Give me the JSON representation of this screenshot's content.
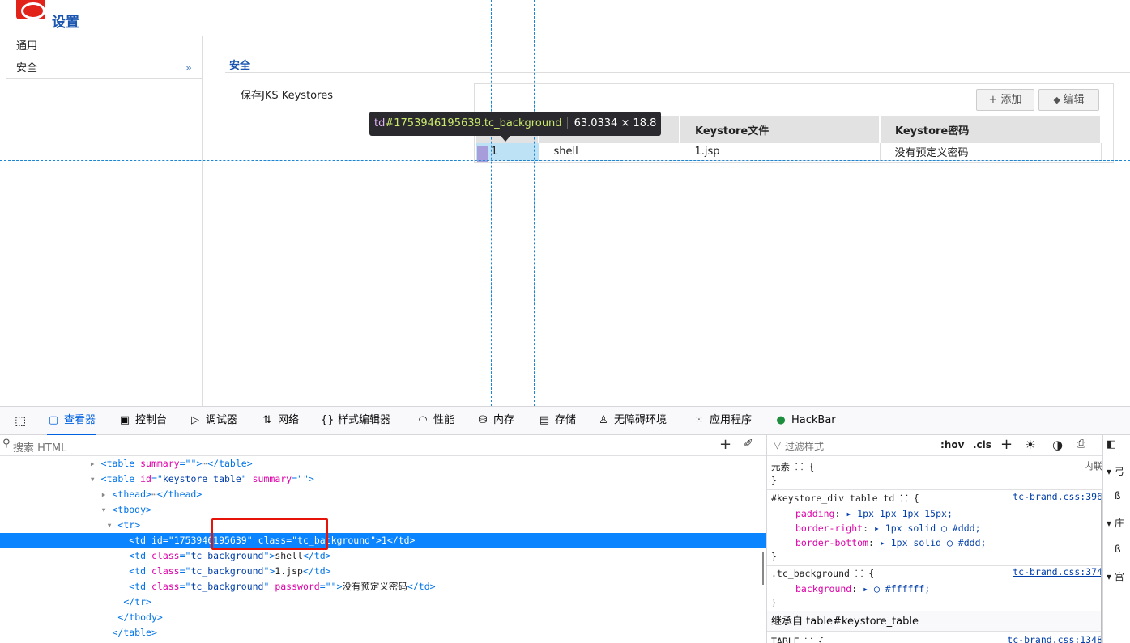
{
  "page": {
    "title": "设置"
  },
  "sidebar": {
    "items": [
      {
        "label": "通用"
      },
      {
        "label": "安全"
      }
    ],
    "chevron": "»"
  },
  "section": {
    "title": "安全",
    "keystore_label": "保存JKS Keystores"
  },
  "buttons": {
    "add": "添加",
    "edit": "编辑"
  },
  "keystore_table": {
    "headers": [
      "",
      "",
      "Keystore文件",
      "Keystore密码"
    ],
    "rows": [
      [
        "1",
        "shell",
        "1.jsp",
        "没有预定义密码"
      ]
    ]
  },
  "tooltip": {
    "tag": "td",
    "id": "#1753946195639",
    "cls": ".tc_background",
    "dims": "63.0334 × 18.8"
  },
  "devtools": {
    "tabs": [
      "查看器",
      "控制台",
      "调试器",
      "网络",
      "样式编辑器",
      "性能",
      "内存",
      "存储",
      "无障碍环境",
      "应用程序",
      "HackBar"
    ],
    "search_placeholder": "搜索 HTML",
    "filter_placeholder": "过滤样式",
    "hov": ":hov",
    "cls": ".cls",
    "markup": [
      {
        "indent": 14,
        "tw": "▸",
        "parts": [
          [
            "tg",
            "<table "
          ],
          [
            "an",
            "summary"
          ],
          [
            "tg",
            "=\""
          ],
          [
            "av",
            ""
          ],
          [
            "tg",
            "\">"
          ],
          [
            "tw",
            "⋯"
          ],
          [
            "tg",
            "</table>"
          ]
        ]
      },
      {
        "indent": 14,
        "tw": "▾",
        "parts": [
          [
            "tg",
            "<table "
          ],
          [
            "an",
            "id"
          ],
          [
            "tg",
            "=\""
          ],
          [
            "av",
            "keystore_table"
          ],
          [
            "tg",
            "\" "
          ],
          [
            "an",
            "summary"
          ],
          [
            "tg",
            "=\"\">"
          ]
        ]
      },
      {
        "indent": 15,
        "tw": "▸",
        "parts": [
          [
            "tg",
            "<thead>"
          ],
          [
            "tw",
            "⋯"
          ],
          [
            "tg",
            "</thead>"
          ]
        ]
      },
      {
        "indent": 15,
        "tw": "▾",
        "parts": [
          [
            "tg",
            "<tbody>"
          ]
        ]
      },
      {
        "indent": 16,
        "tw": "▾",
        "parts": [
          [
            "tg",
            "<tr>"
          ]
        ]
      },
      {
        "indent": 18,
        "tw": "",
        "sel": true,
        "parts": [
          [
            "tg",
            "<td "
          ],
          [
            "an",
            "id"
          ],
          [
            "tg",
            "=\""
          ],
          [
            "av",
            "1753946195639"
          ],
          [
            "tg",
            "\" "
          ],
          [
            "an",
            "class"
          ],
          [
            "tg",
            "=\""
          ],
          [
            "av",
            "tc_background"
          ],
          [
            "tg",
            "\">"
          ],
          [
            "",
            ""
          ],
          [
            "",
            "1"
          ],
          [
            "tg",
            "</td>"
          ]
        ]
      },
      {
        "indent": 18,
        "tw": "",
        "parts": [
          [
            "tg",
            "<td "
          ],
          [
            "an",
            "class"
          ],
          [
            "tg",
            "=\""
          ],
          [
            "av",
            "tc_background"
          ],
          [
            "tg",
            "\">"
          ],
          [
            "",
            "shell"
          ],
          [
            "tg",
            "</td>"
          ]
        ]
      },
      {
        "indent": 18,
        "tw": "",
        "parts": [
          [
            "tg",
            "<td "
          ],
          [
            "an",
            "class"
          ],
          [
            "tg",
            "=\""
          ],
          [
            "av",
            "tc_background"
          ],
          [
            "tg",
            "\">"
          ],
          [
            "",
            "1.jsp"
          ],
          [
            "tg",
            "</td>"
          ]
        ]
      },
      {
        "indent": 18,
        "tw": "",
        "parts": [
          [
            "tg",
            "<td "
          ],
          [
            "an",
            "class"
          ],
          [
            "tg",
            "=\""
          ],
          [
            "av",
            "tc_background"
          ],
          [
            "tg",
            "\" "
          ],
          [
            "an",
            "password"
          ],
          [
            "tg",
            "=\"\">"
          ],
          [
            "",
            "没有预定义密码"
          ],
          [
            "tg",
            "</td>"
          ]
        ]
      },
      {
        "indent": 17,
        "tw": "",
        "parts": [
          [
            "tg",
            "</tr>"
          ]
        ]
      },
      {
        "indent": 16,
        "tw": "",
        "parts": [
          [
            "tg",
            "</tbody>"
          ]
        ]
      },
      {
        "indent": 15,
        "tw": "",
        "parts": [
          [
            "tg",
            "</table>"
          ]
        ]
      }
    ],
    "rules": {
      "element": {
        "selector": "元素 ⸬ {",
        "close": "}",
        "source": "内联"
      },
      "r1": {
        "selector": "#keystore_div table td ⸬ {",
        "source": "tc-brand.css:396",
        "decls": [
          [
            "padding",
            "▸ 1px 1px 1px 15px;"
          ],
          [
            "border-right",
            "▸ 1px solid ◯ #ddd;"
          ],
          [
            "border-bottom",
            "▸ 1px solid ◯ #ddd;"
          ]
        ]
      },
      "r2": {
        "selector": ".tc_background ⸬ {",
        "source": "tc-brand.css:374",
        "decls": [
          [
            "background",
            "▸ ◯ #ffffff;"
          ]
        ]
      },
      "inherit_label": "继承自 table#keystore_table",
      "r3": {
        "selector": "TABLE ⸬ {",
        "source": "tc-brand.css:1348"
      }
    },
    "side": [
      "弓",
      "ß",
      "庄",
      "宫"
    ]
  },
  "colors": {
    "brand": "#e2231a",
    "link": "#1a55b0",
    "devtools_accent": "#0061e0",
    "selection": "#0a84ff",
    "highlight": "#e5130a"
  }
}
